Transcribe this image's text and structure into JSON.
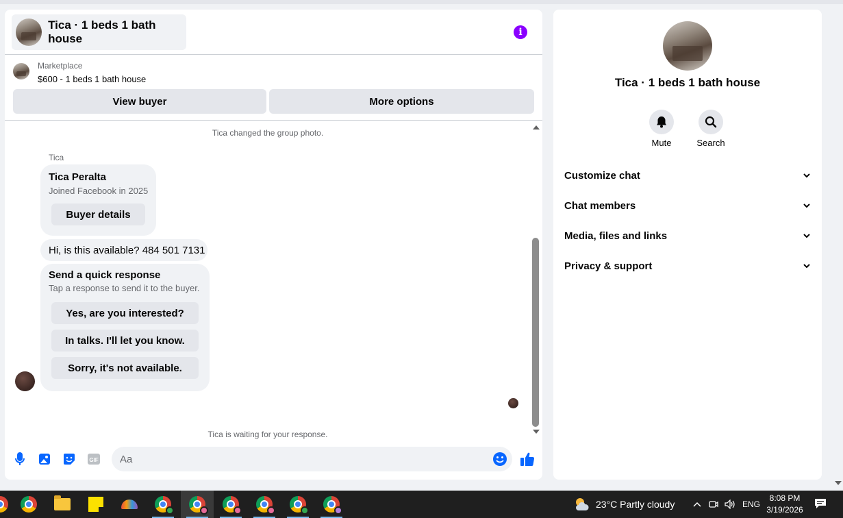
{
  "chat": {
    "title": "Tica · 1 beds 1 bath house",
    "listing": {
      "source": "Marketplace",
      "price_title": "$600 - 1 beds 1 bath house",
      "view_buyer_label": "View buyer",
      "more_options_label": "More options"
    },
    "messages": {
      "system_top": "Tica changed the group photo.",
      "sender_name": "Tica",
      "profile_card": {
        "name": "Tica Peralta",
        "joined": "Joined Facebook in 2025",
        "button": "Buyer details"
      },
      "text_message": "Hi, is this available? 484 501 7131",
      "quick_response": {
        "title": "Send a quick response",
        "subtitle": "Tap a response to send it to the buyer.",
        "options": [
          "Yes, are you interested?",
          "In talks. I'll let you know.",
          "Sorry, it's not available."
        ]
      },
      "system_bottom": "Tica is waiting for your response."
    },
    "composer": {
      "placeholder": "Aa",
      "icons": [
        "microphone-icon",
        "photo-icon",
        "sticker-icon",
        "gif-icon",
        "emoji-icon",
        "thumbs-up-icon"
      ],
      "gif_text": "GIF"
    },
    "accent_color": "#0866ff"
  },
  "side": {
    "title": "Tica · 1 beds 1 bath house",
    "actions": {
      "mute": "Mute",
      "search": "Search"
    },
    "sections": [
      "Customize chat",
      "Chat members",
      "Media, files and links",
      "Privacy & support"
    ]
  },
  "taskbar": {
    "weather": "23°C  Partly cloudy",
    "language": "ENG",
    "time": "8:08 PM",
    "date": "3/19/2026"
  }
}
